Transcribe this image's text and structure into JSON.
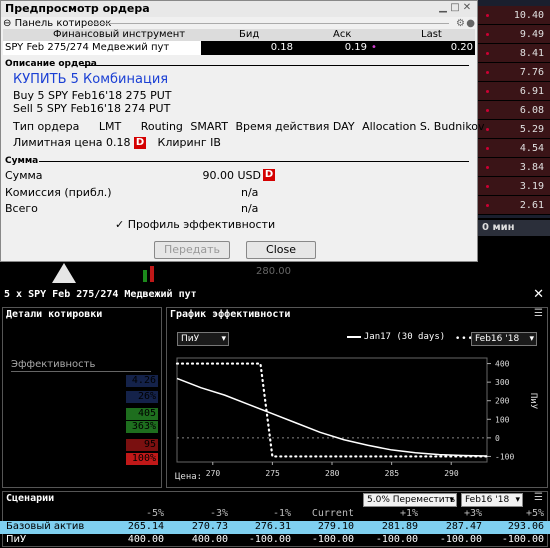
{
  "background": {
    "right_prices": [
      "10.40",
      "9.49",
      "8.41",
      "7.76",
      "6.91",
      "6.08",
      "5.29",
      "4.54",
      "3.84",
      "3.19",
      "2.61"
    ],
    "tab_label": "0 мин свечи",
    "chart_price": "280.00"
  },
  "preview": {
    "title": "Предпросмотр ордера",
    "quote_panel_label": "Панель котировок",
    "quote_headers": [
      "Финансовый инструмент",
      "Бид",
      "Аск",
      "Last"
    ],
    "quote_row": {
      "instrument": "SPY Feb 275/274 Медвежий пут",
      "bid": "0.18",
      "ask": "0.19",
      "last": "0.20"
    },
    "description_label": "Описание ордера",
    "buy_line": "КУПИТЬ 5 Комбинация",
    "leg1": "Buy 5 SPY Feb16'18 275 PUT",
    "leg2": "Sell 5 SPY Feb16'18 274 PUT",
    "order_type_label": "Тип ордера",
    "order_type_value": "LMT",
    "routing_label": "Routing",
    "routing_value": "SMART",
    "tif_label": "Время действия",
    "tif_value": "DAY",
    "allocation_label": "Allocation",
    "allocation_value": "S. Budnikov",
    "limit_label": "Лимитная цена",
    "limit_value": "0.18",
    "d_badge": "D",
    "clearing_label": "Клиринг",
    "clearing_value": "IB",
    "amount_section": "Сумма",
    "amount_label": "Сумма",
    "amount_value": "90.00",
    "amount_currency": "USD",
    "commission_label": "Комиссия (прибл.)",
    "commission_value": "n/a",
    "total_label": "Всего",
    "total_value": "n/a",
    "profile_checkbox": "Профиль эффективности",
    "transmit_button": "Передать",
    "close_button": "Close"
  },
  "combo": {
    "title": "5 x SPY Feb 275/274 Медвежий пут",
    "quote_details": {
      "header": "Детали котировки",
      "bid_ask_label": "Бид/аск",
      "bid_ask_value": "0.18 x 0.19",
      "size_label": "Размер",
      "size_value": "5 x 295",
      "efficiency_label": "Эффективность",
      "return_risk_label": "Доход/риск",
      "return_risk_value": "4.26",
      "probability_label": "Вероятность дохода",
      "probability_value": "26%",
      "max_return_label": "Макс. доходность",
      "max_return_value": "405",
      "max_return_pct_label": "(22% возможность)",
      "max_return_pct_value": "363%",
      "max_loss_label": "Макс. убытки",
      "max_loss_value": "95",
      "max_loss_pct_label": "(73% возможность)",
      "max_loss_pct_value": "100%"
    },
    "perf_chart": {
      "header": "График эффективности",
      "metric_select": "ПиУ",
      "legend_jan": "Jan17 (30 days)",
      "legend_feb_select": "Feb16 '18",
      "price_label": "Цена:",
      "y_axis_label": "ПиУ"
    },
    "scenarios": {
      "header": "Сценарии",
      "shift_select": "5.0% Переместить",
      "date_select": "Feb16 '18",
      "columns": [
        "-5%",
        "-3%",
        "-1%",
        "Current",
        "+1%",
        "+3%",
        "+5%"
      ],
      "rows": [
        {
          "label": "Базовый актив",
          "values": [
            "265.14",
            "270.73",
            "276.31",
            "279.10",
            "281.89",
            "287.47",
            "293.06"
          ]
        },
        {
          "label": "ПиУ",
          "values": [
            "400.00",
            "400.00",
            "-100.00",
            "-100.00",
            "-100.00",
            "-100.00",
            "-100.00"
          ]
        }
      ]
    }
  },
  "chart_data": {
    "type": "line",
    "title": "",
    "xlabel": "",
    "ylabel": "ПиУ",
    "x_ticks": [
      270,
      275,
      280,
      285,
      290
    ],
    "y_ticks": [
      400,
      300,
      200,
      100,
      0,
      -100
    ],
    "xlim": [
      267,
      293
    ],
    "ylim": [
      -130,
      430
    ],
    "series": [
      {
        "name": "Jan17 (30 days)",
        "style": "solid",
        "x": [
          267,
          269,
          271,
          273,
          275,
          277,
          279,
          281,
          283,
          285,
          287,
          289,
          291,
          293
        ],
        "y": [
          320,
          270,
          230,
          180,
          130,
          80,
          30,
          -10,
          -40,
          -65,
          -80,
          -90,
          -95,
          -98
        ]
      },
      {
        "name": "Feb16 '18",
        "style": "dotted",
        "x": [
          267,
          274,
          275,
          293
        ],
        "y": [
          400,
          400,
          -100,
          -100
        ]
      }
    ]
  }
}
